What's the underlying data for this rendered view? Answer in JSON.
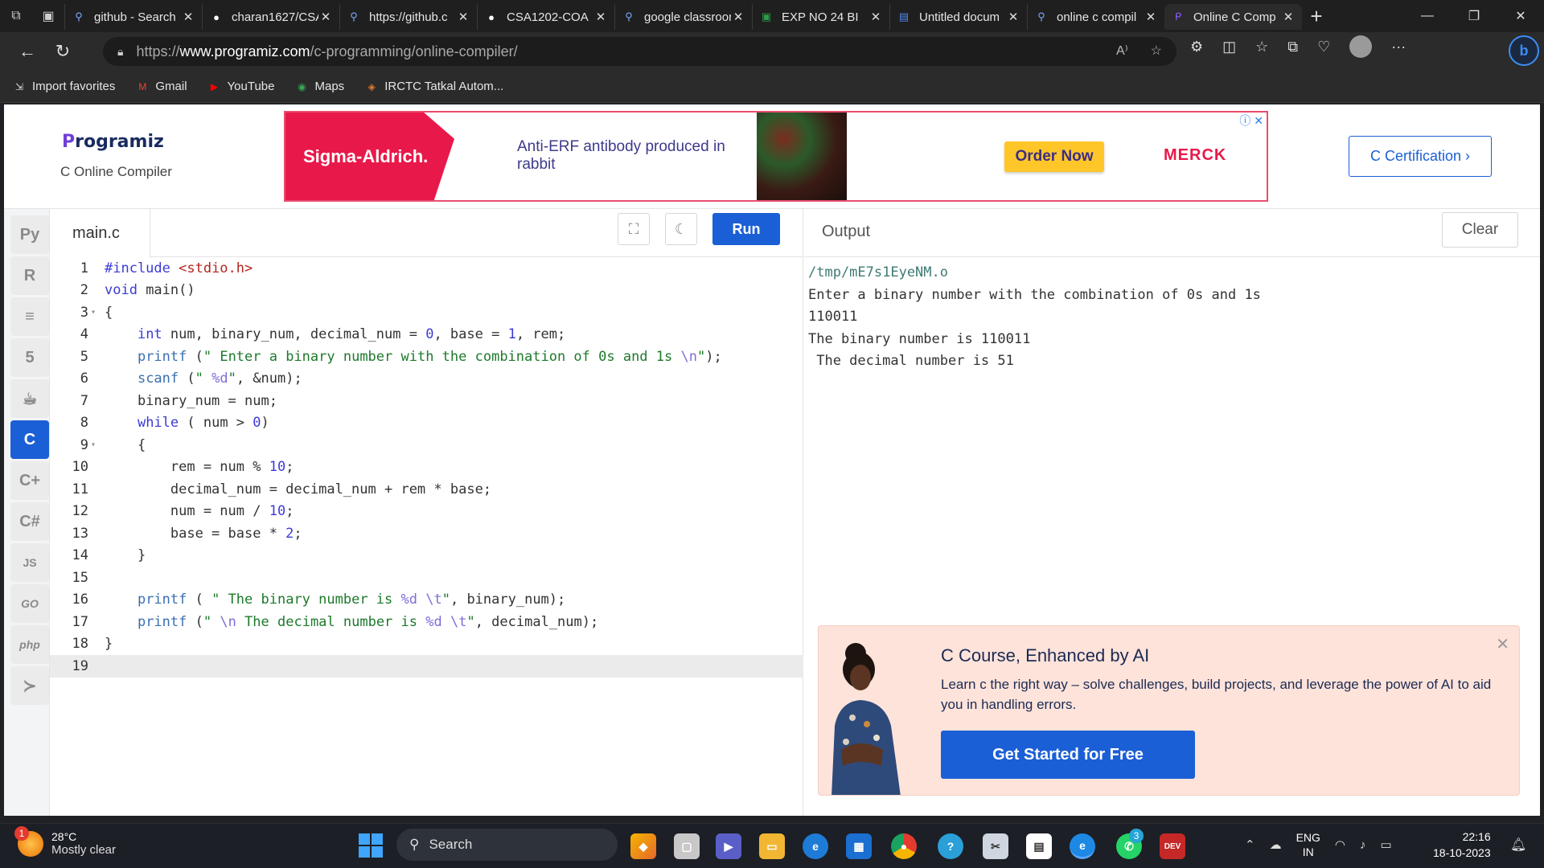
{
  "browser": {
    "tabs": [
      {
        "title": "github - Search",
        "favicon": "search-icon"
      },
      {
        "title": "charan1627/CSA",
        "favicon": "github-icon"
      },
      {
        "title": "https://github.c",
        "favicon": "search-icon"
      },
      {
        "title": "CSA1202-COA",
        "favicon": "github-icon"
      },
      {
        "title": "google classroom",
        "favicon": "search-icon"
      },
      {
        "title": "EXP NO 24 BI",
        "favicon": "classroom-icon"
      },
      {
        "title": "Untitled docum",
        "favicon": "docs-icon"
      },
      {
        "title": "online c compil",
        "favicon": "search-icon"
      },
      {
        "title": "Online C Comp",
        "favicon": "programiz-icon",
        "active": true
      }
    ],
    "url_prefix": "https://",
    "url_host": "www.programiz.com",
    "url_path": "/c-programming/online-compiler/",
    "favorites": [
      {
        "label": "Import favorites",
        "icon": "import-icon"
      },
      {
        "label": "Gmail",
        "icon": "gmail-icon"
      },
      {
        "label": "YouTube",
        "icon": "youtube-icon"
      },
      {
        "label": "Maps",
        "icon": "maps-icon"
      },
      {
        "label": "IRCTC Tatkal Autom...",
        "icon": "irctc-icon"
      }
    ]
  },
  "site": {
    "logo": "Programiz",
    "logo_first": "P",
    "logo_rest": "rogramiz",
    "subtitle": "C Online Compiler",
    "certification": "C Certification ›"
  },
  "ad": {
    "brand": "Sigma-Aldrich.",
    "text": "Anti-ERF antibody produced in rabbit",
    "cta": "Order Now",
    "partner": "MERCK"
  },
  "editor": {
    "file_tab": "main.c",
    "run_label": "Run",
    "lines": [
      {
        "n": "1",
        "fold": "",
        "text": "#include <stdio.h>"
      },
      {
        "n": "2",
        "fold": "",
        "text": "void main()"
      },
      {
        "n": "3",
        "fold": "▾",
        "text": "{"
      },
      {
        "n": "4",
        "fold": "",
        "text": "    int num, binary_num, decimal_num = 0, base = 1, rem;"
      },
      {
        "n": "5",
        "fold": "",
        "text": "    printf (\" Enter a binary number with the combination of 0s and 1s \\n\");"
      },
      {
        "n": "6",
        "fold": "",
        "text": "    scanf (\" %d\", &num);"
      },
      {
        "n": "7",
        "fold": "",
        "text": "    binary_num = num;"
      },
      {
        "n": "8",
        "fold": "",
        "text": "    while ( num > 0)"
      },
      {
        "n": "9",
        "fold": "▾",
        "text": "    {"
      },
      {
        "n": "10",
        "fold": "",
        "text": "        rem = num % 10;"
      },
      {
        "n": "11",
        "fold": "",
        "text": "        decimal_num = decimal_num + rem * base;"
      },
      {
        "n": "12",
        "fold": "",
        "text": "        num = num / 10;"
      },
      {
        "n": "13",
        "fold": "",
        "text": "        base = base * 2;"
      },
      {
        "n": "14",
        "fold": "",
        "text": "    }"
      },
      {
        "n": "15",
        "fold": "",
        "text": ""
      },
      {
        "n": "16",
        "fold": "",
        "text": "    printf ( \" The binary number is %d \\t\", binary_num);"
      },
      {
        "n": "17",
        "fold": "",
        "text": "    printf (\" \\n The decimal number is %d \\t\", decimal_num);"
      },
      {
        "n": "18",
        "fold": "",
        "text": "}"
      },
      {
        "n": "19",
        "fold": "",
        "text": ""
      }
    ]
  },
  "output": {
    "title": "Output",
    "clear_label": "Clear",
    "path": "/tmp/mE7s1EyeNM.o",
    "lines": [
      "Enter a binary number with the combination of 0s and 1s",
      "110011",
      "The binary number is 110011",
      " The decimal number is 51"
    ]
  },
  "promo": {
    "title": "C Course, Enhanced by AI",
    "description": "Learn c the right way – solve challenges, build projects, and leverage the power of AI to aid you in handling errors.",
    "cta": "Get Started for Free"
  },
  "taskbar": {
    "weather_badge": "1",
    "temperature": "28°C",
    "condition": "Mostly clear",
    "search_placeholder": "Search",
    "whatsapp_badge": "3",
    "lang_top": "ENG",
    "lang_bottom": "IN",
    "time": "22:16",
    "date": "18-10-2023"
  }
}
